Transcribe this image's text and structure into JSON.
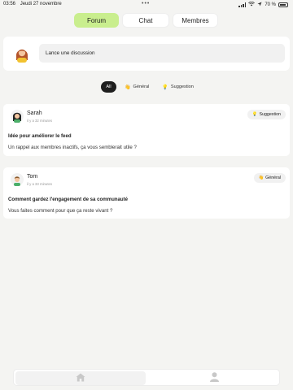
{
  "status": {
    "time": "03:56",
    "date": "Jeudi 27 novembre",
    "battery": "70 %"
  },
  "tabs": [
    {
      "label": "Forum",
      "active": true
    },
    {
      "label": "Chat",
      "active": false
    },
    {
      "label": "Membres",
      "active": false
    }
  ],
  "composer": {
    "placeholder": "Lance une discussion"
  },
  "filters": [
    {
      "label": "All",
      "active": true
    },
    {
      "label": "Général",
      "icon": "👋",
      "active": false
    },
    {
      "label": "Suggestion",
      "icon": "💡",
      "active": false
    }
  ],
  "posts": [
    {
      "author": "Sarah",
      "time": "il y a 32 minutes",
      "badge": "Suggestion",
      "badge_icon": "💡",
      "title": "Idée pour améliorer le feed",
      "body": "Un rappel aux membres inactifs, ça vous semblerait utile ?"
    },
    {
      "author": "Tom",
      "time": "il y a 33 minutes",
      "badge": "Général",
      "badge_icon": "👋",
      "title": "Comment gardez l'engagement de sa communauté",
      "body": "Vous faites comment pour que ça reste vivant ?"
    }
  ],
  "colors": {
    "accent": "#c9ee8e",
    "background": "#f4f4f2",
    "chip_active": "#1e1e1e"
  }
}
